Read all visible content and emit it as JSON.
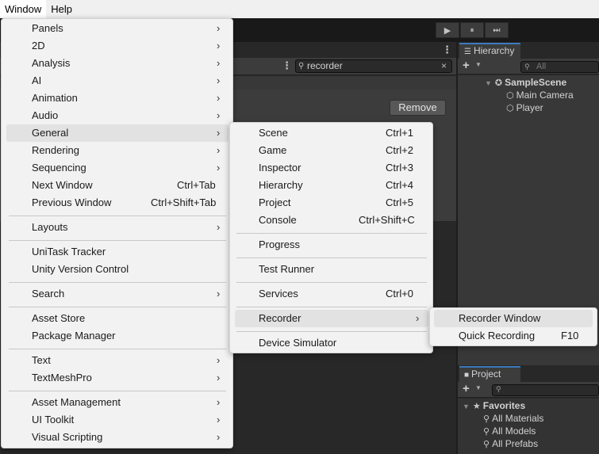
{
  "menubar": {
    "items": [
      "Window",
      "Help"
    ]
  },
  "toolbar": {
    "play_icon": "▶",
    "pause_icon": "⏸",
    "step_icon": "⏭"
  },
  "left_panel": {
    "search_value": "recorder",
    "search_icon": "search-icon",
    "clear_icon": "×",
    "more_icon": "⋮",
    "remove_label": "Remove"
  },
  "hierarchy": {
    "tab_label": "Hierarchy",
    "add_label": "+",
    "search_placeholder": "All",
    "scene_name": "SampleScene",
    "items": [
      "Main Camera",
      "Player"
    ]
  },
  "project": {
    "tab_label": "Project",
    "add_label": "+",
    "favorites_label": "Favorites",
    "items": [
      "All Materials",
      "All Models",
      "All Prefabs"
    ]
  },
  "window_menu": {
    "items": [
      {
        "label": "Panels",
        "arrow": "›"
      },
      {
        "label": "2D",
        "arrow": "›"
      },
      {
        "label": "Analysis",
        "arrow": "›"
      },
      {
        "label": "AI",
        "arrow": "›"
      },
      {
        "label": "Animation",
        "arrow": "›"
      },
      {
        "label": "Audio",
        "arrow": "›"
      },
      {
        "label": "General",
        "arrow": "›"
      },
      {
        "label": "Rendering",
        "arrow": "›"
      },
      {
        "label": "Sequencing",
        "arrow": "›"
      },
      {
        "label": "Next Window",
        "shortcut": "Ctrl+Tab"
      },
      {
        "label": "Previous Window",
        "shortcut": "Ctrl+Shift+Tab"
      },
      {
        "label": "Layouts",
        "arrow": "›"
      },
      {
        "label": "UniTask Tracker"
      },
      {
        "label": "Unity Version Control"
      },
      {
        "label": "Search",
        "arrow": "›"
      },
      {
        "label": "Asset Store"
      },
      {
        "label": "Package Manager"
      },
      {
        "label": "Text",
        "arrow": "›"
      },
      {
        "label": "TextMeshPro",
        "arrow": "›"
      },
      {
        "label": "Asset Management",
        "arrow": "›"
      },
      {
        "label": "UI Toolkit",
        "arrow": "›"
      },
      {
        "label": "Visual Scripting",
        "arrow": "›"
      }
    ]
  },
  "general_menu": {
    "items": [
      {
        "label": "Scene",
        "shortcut": "Ctrl+1"
      },
      {
        "label": "Game",
        "shortcut": "Ctrl+2"
      },
      {
        "label": "Inspector",
        "shortcut": "Ctrl+3"
      },
      {
        "label": "Hierarchy",
        "shortcut": "Ctrl+4"
      },
      {
        "label": "Project",
        "shortcut": "Ctrl+5"
      },
      {
        "label": "Console",
        "shortcut": "Ctrl+Shift+C"
      },
      {
        "label": "Progress"
      },
      {
        "label": "Test Runner"
      },
      {
        "label": "Services",
        "shortcut": "Ctrl+0"
      },
      {
        "label": "Recorder",
        "arrow": "›"
      },
      {
        "label": "Device Simulator"
      }
    ]
  },
  "recorder_menu": {
    "items": [
      {
        "label": "Recorder Window"
      },
      {
        "label": "Quick Recording",
        "shortcut": "F10"
      }
    ]
  }
}
